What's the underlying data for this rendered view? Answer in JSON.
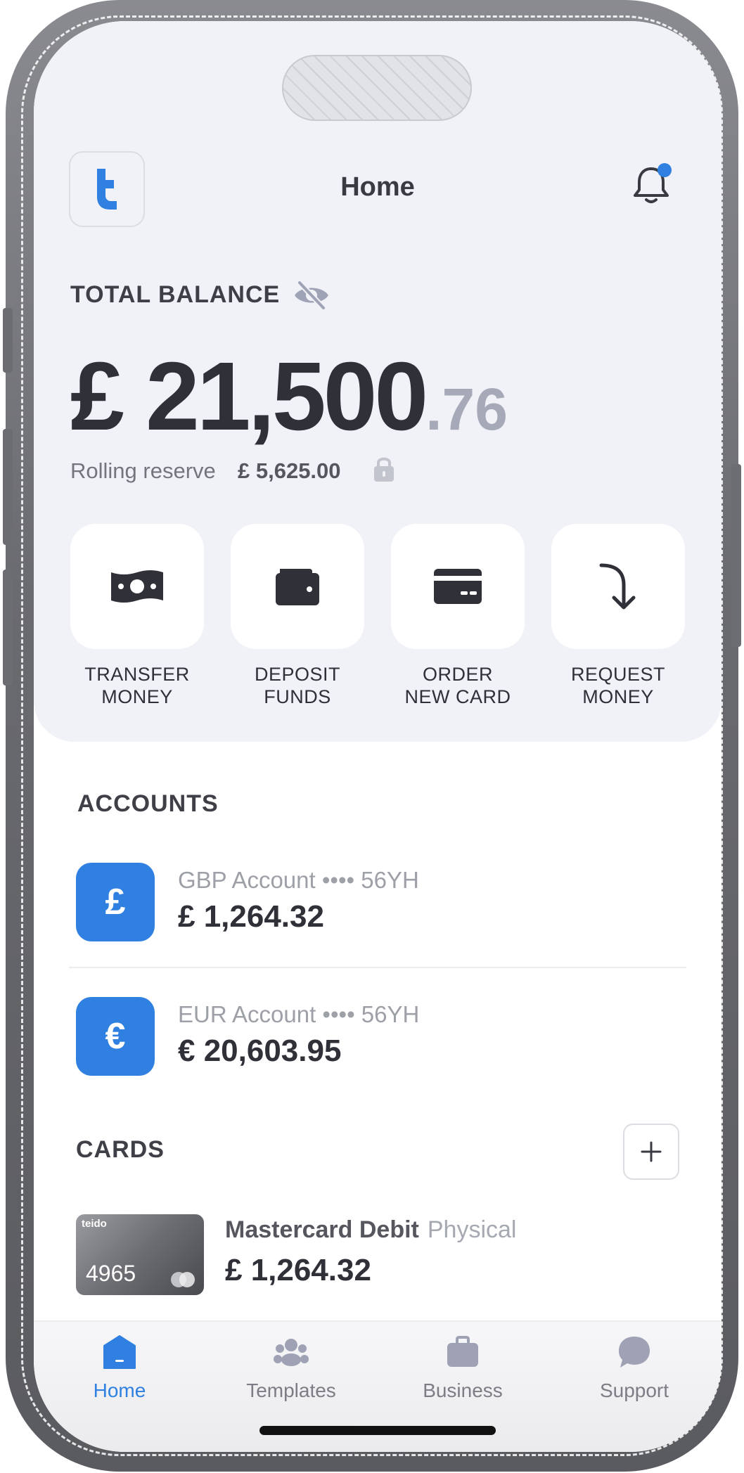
{
  "header": {
    "title": "Home",
    "has_notification": true
  },
  "balance": {
    "label": "TOTAL BALANCE",
    "main": "£ 21,500",
    "cents": ".76",
    "reserve_label": "Rolling reserve",
    "reserve_value": "£ 5,625.00"
  },
  "actions": [
    {
      "label": "TRANSFER\nMONEY",
      "icon": "banknote-icon"
    },
    {
      "label": "DEPOSIT\nFUNDS",
      "icon": "wallet-icon"
    },
    {
      "label": "ORDER\nNEW CARD",
      "icon": "credit-card-icon"
    },
    {
      "label": "REQUEST\nMONEY",
      "icon": "arrow-curve-down-icon"
    }
  ],
  "accounts": {
    "title": "ACCOUNTS",
    "items": [
      {
        "symbol": "£",
        "name": "GBP Account •••• 56YH",
        "amount": "£ 1,264.32"
      },
      {
        "symbol": "€",
        "name": "EUR Account •••• 56YH",
        "amount": "€ 20,603.95"
      }
    ]
  },
  "cards": {
    "title": "CARDS",
    "items": [
      {
        "brand": "teido",
        "last4": "4965",
        "name": "Mastercard Debit",
        "type": "Physical",
        "amount": "£ 1,264.32"
      }
    ]
  },
  "tabbar": {
    "items": [
      {
        "label": "Home",
        "icon": "home-icon",
        "active": true
      },
      {
        "label": "Templates",
        "icon": "people-icon",
        "active": false
      },
      {
        "label": "Business",
        "icon": "briefcase-icon",
        "active": false
      },
      {
        "label": "Support",
        "icon": "chat-bubble-icon",
        "active": false
      }
    ]
  },
  "colors": {
    "accent": "#2f80e0",
    "background_top": "#f1f2f7",
    "text_primary": "#2f3038",
    "text_muted": "#9ea0a8"
  }
}
